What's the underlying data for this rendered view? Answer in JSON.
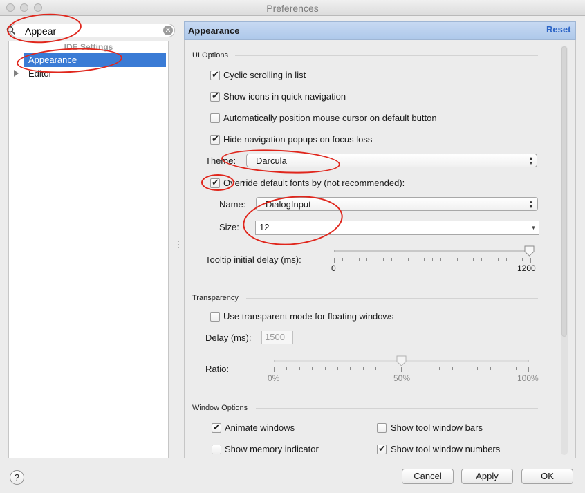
{
  "window": {
    "title": "Preferences"
  },
  "search": {
    "value": "Appear"
  },
  "tree": {
    "section": "IDE Settings",
    "items": [
      {
        "label": "Appearance",
        "selected": true
      },
      {
        "label": "Editor",
        "expandable": true
      }
    ]
  },
  "panel": {
    "title": "Appearance",
    "reset_label": "Reset"
  },
  "ui_options": {
    "title": "UI Options",
    "checkboxes": [
      {
        "label": "Cyclic scrolling in list",
        "checked": true
      },
      {
        "label": "Show icons in quick navigation",
        "checked": true
      },
      {
        "label": "Automatically position mouse cursor on default button",
        "checked": false
      },
      {
        "label": "Hide navigation popups on focus loss",
        "checked": true
      }
    ],
    "theme_label": "Theme:",
    "theme_value": "Darcula",
    "override_label": "Override default fonts by (not recommended):",
    "override_checked": true,
    "name_label": "Name:",
    "name_value": "DialogInput",
    "size_label": "Size:",
    "size_value": "12",
    "tooltip_label": "Tooltip initial delay (ms):",
    "tooltip_min": "0",
    "tooltip_max": "1200",
    "tooltip_value": 1200
  },
  "transparency": {
    "title": "Transparency",
    "checkbox_label": "Use transparent mode for floating windows",
    "checkbox_checked": false,
    "delay_label": "Delay (ms):",
    "delay_value": "1500",
    "ratio_label": "Ratio:",
    "ratio_ticks": [
      "0%",
      "50%",
      "100%"
    ],
    "ratio_value": 0.5
  },
  "window_options": {
    "title": "Window Options",
    "checkboxes": [
      {
        "label": "Animate windows",
        "checked": true
      },
      {
        "label": "Show tool window bars",
        "checked": false
      },
      {
        "label": "Show memory indicator",
        "checked": false
      },
      {
        "label": "Show tool window numbers",
        "checked": true
      }
    ]
  },
  "buttons": {
    "help": "?",
    "cancel": "Cancel",
    "apply": "Apply",
    "ok": "OK"
  },
  "colors": {
    "selection": "#3a7bd5",
    "link": "#2b64c6",
    "annotation": "#e0261c"
  }
}
